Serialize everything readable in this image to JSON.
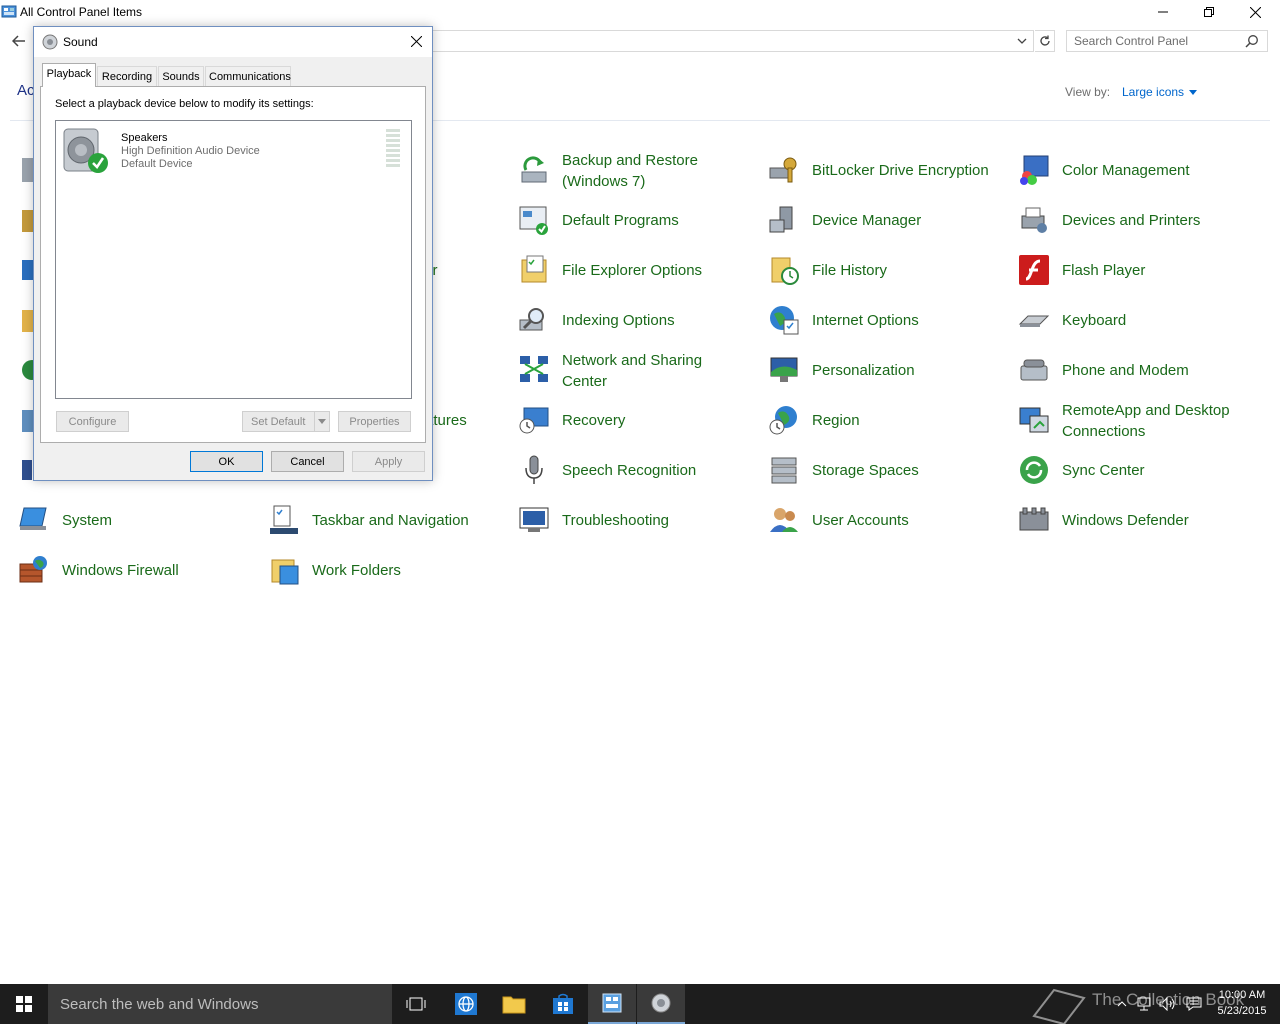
{
  "window": {
    "title": "All Control Panel Items",
    "minimize_glyph": "—",
    "maximize_glyph": "❐",
    "close_glyph": "✕"
  },
  "toolbar": {
    "search_placeholder": "Search Control Panel",
    "adjust_text": "Ac",
    "view_by_label": "View by:",
    "view_by_value": "Large icons"
  },
  "items": [
    {
      "label": "ter",
      "icon": "security-maintenance-icon"
    },
    {
      "label": "atures",
      "icon": "programs-features-icon"
    },
    {
      "label": "Backup and Restore\n(Windows 7)",
      "icon": "backup-restore-icon"
    },
    {
      "label": "BitLocker Drive Encryption",
      "icon": "bitlocker-icon"
    },
    {
      "label": "Color Management",
      "icon": "color-management-icon"
    },
    {
      "label": "Default Programs",
      "icon": "default-programs-icon"
    },
    {
      "label": "Device Manager",
      "icon": "device-manager-icon"
    },
    {
      "label": "Devices and Printers",
      "icon": "devices-printers-icon"
    },
    {
      "label": "File Explorer Options",
      "icon": "file-explorer-options-icon"
    },
    {
      "label": "File History",
      "icon": "file-history-icon"
    },
    {
      "label": "Flash Player",
      "icon": "flash-player-icon"
    },
    {
      "label": "Indexing Options",
      "icon": "indexing-options-icon"
    },
    {
      "label": "Internet Options",
      "icon": "internet-options-icon"
    },
    {
      "label": "Keyboard",
      "icon": "keyboard-icon"
    },
    {
      "label": "Network and Sharing\nCenter",
      "icon": "network-sharing-icon"
    },
    {
      "label": "Personalization",
      "icon": "personalization-icon"
    },
    {
      "label": "Phone and Modem",
      "icon": "phone-modem-icon"
    },
    {
      "label": "Recovery",
      "icon": "recovery-icon"
    },
    {
      "label": "Region",
      "icon": "region-icon"
    },
    {
      "label": "RemoteApp and Desktop\nConnections",
      "icon": "remoteapp-icon"
    },
    {
      "label": "Speech Recognition",
      "icon": "speech-recognition-icon"
    },
    {
      "label": "Storage Spaces",
      "icon": "storage-spaces-icon"
    },
    {
      "label": "Sync Center",
      "icon": "sync-center-icon"
    },
    {
      "label": "System",
      "icon": "system-icon"
    },
    {
      "label": "Taskbar and Navigation",
      "icon": "taskbar-navigation-icon"
    },
    {
      "label": "Troubleshooting",
      "icon": "troubleshooting-icon"
    },
    {
      "label": "User Accounts",
      "icon": "user-accounts-icon"
    },
    {
      "label": "Windows Defender",
      "icon": "windows-defender-icon"
    },
    {
      "label": "Windows Firewall",
      "icon": "windows-firewall-icon"
    },
    {
      "label": "Work Folders",
      "icon": "work-folders-icon"
    }
  ],
  "sound_dialog": {
    "title": "Sound",
    "tabs": [
      "Playback",
      "Recording",
      "Sounds",
      "Communications"
    ],
    "active_tab": "Playback",
    "instruction": "Select a playback device below to modify its settings:",
    "device": {
      "name": "Speakers",
      "description": "High Definition Audio Device",
      "status": "Default Device"
    },
    "buttons": {
      "configure": "Configure",
      "set_default": "Set Default",
      "properties": "Properties",
      "ok": "OK",
      "cancel": "Cancel",
      "apply": "Apply"
    }
  },
  "taskbar": {
    "search_placeholder": "Search the web and Windows",
    "watermark": "The Collection Book",
    "time": "10:00 AM",
    "date": "5/23/2015"
  },
  "colors": {
    "link_green": "#1a6a1a",
    "taskbar_bg": "#1d1d1d",
    "accent_blue": "#0078d7"
  }
}
